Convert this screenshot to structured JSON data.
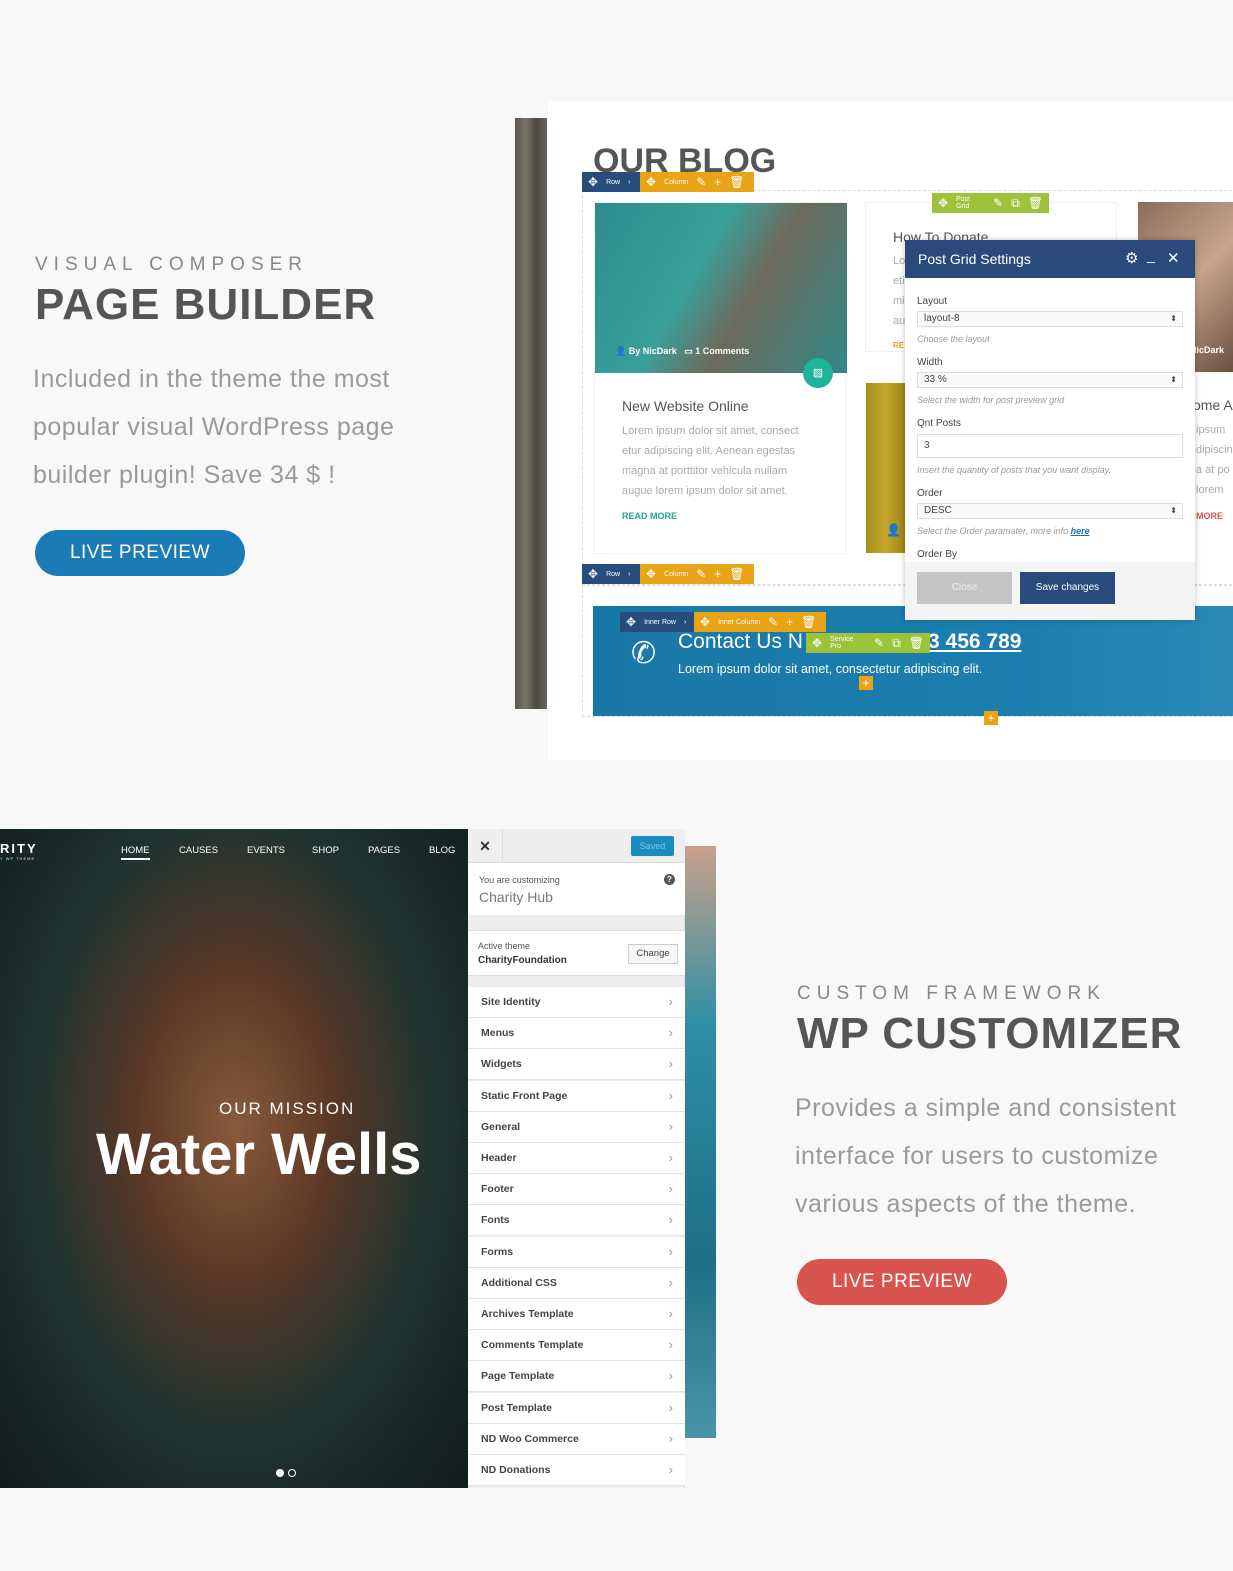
{
  "section1": {
    "kicker": "VISUAL COMPOSER",
    "title": "PAGE BUILDER",
    "description_lines": [
      "Included in the theme the most",
      "popular visual WordPress page",
      "builder plugin! Save 34 $ !"
    ],
    "button": "LIVE PREVIEW",
    "accent": "#1a7bb5"
  },
  "builder": {
    "blog_title": "OUR BLOG",
    "toolbar": {
      "row": "Row",
      "column": "Column",
      "post_grid": "Post Grid",
      "inner_row": "Inner Row",
      "inner_column": "Inner Column",
      "service_pro": "Service Pro"
    },
    "card1": {
      "author": "By NicDark",
      "comments": "1 Comments",
      "title": "New Website Online",
      "body_lines": [
        "Lorem ipsum dolor sit amet, consect",
        "etur adipiscing elit. Aenean egestas",
        "magna at porttitor vehicula nullam",
        "augue lorem ipsum dolor sit amet."
      ],
      "read_more": "READ MORE"
    },
    "card2": {
      "title": "How To Donate",
      "frag_lines": [
        "Lo",
        "eti",
        "mi",
        "au"
      ],
      "read_more": "RE."
    },
    "card3": {
      "author": "NicDark",
      "title": "ome A",
      "frag_lines": [
        "ipsum",
        "dipiscin",
        "a at po",
        "lorem"
      ],
      "read_more": "MORE"
    },
    "modal": {
      "title": "Post Grid Settings",
      "fields": [
        {
          "label": "Layout",
          "value": "layout-8",
          "help": "Choose the layout"
        },
        {
          "label": "Width",
          "value": "33 %",
          "help": "Select the width for post preview grid"
        },
        {
          "label": "Qnt Posts",
          "value": "3",
          "help": "Insert the quantity of posts that you want display."
        },
        {
          "label": "Order",
          "value": "DESC",
          "help": "Select the Order paramater, more info ",
          "help_link": "here"
        },
        {
          "label": "Order By"
        }
      ],
      "close": "Close",
      "save": "Save changes",
      "header_color": "#2a4a7c"
    },
    "contact": {
      "title": "Contact Us N",
      "phone": "3 456 789",
      "text": "Lorem ipsum dolor sit amet, consectetur adipiscing elit."
    }
  },
  "site": {
    "logo": "RITY",
    "logo_sub": "Y WP THEME",
    "nav": [
      "HOME",
      "CAUSES",
      "EVENTS",
      "SHOP",
      "PAGES",
      "BLOG"
    ],
    "mission": "OUR MISSION",
    "hero": "Water Wells"
  },
  "customizer": {
    "saved": "Saved",
    "customizing_label": "You are customizing",
    "site_name": "Charity Hub",
    "active_theme_label": "Active theme",
    "theme_name": "CharityFoundation",
    "change": "Change",
    "items": [
      "Site Identity",
      "Menus",
      "Widgets",
      "Static Front Page",
      "General",
      "Header",
      "Footer",
      "Fonts",
      "Forms",
      "Additional CSS",
      "Archives Template",
      "Comments Template",
      "Page Template",
      "Post Template",
      "ND Woo Commerce",
      "ND Donations"
    ]
  },
  "section2": {
    "kicker": "CUSTOM FRAMEWORK",
    "title": "WP CUSTOMIZER",
    "description_lines": [
      "Provides a simple and consistent",
      "interface for users to customize",
      "various aspects of the theme."
    ],
    "button": "LIVE PREVIEW",
    "accent": "#d9534f"
  }
}
